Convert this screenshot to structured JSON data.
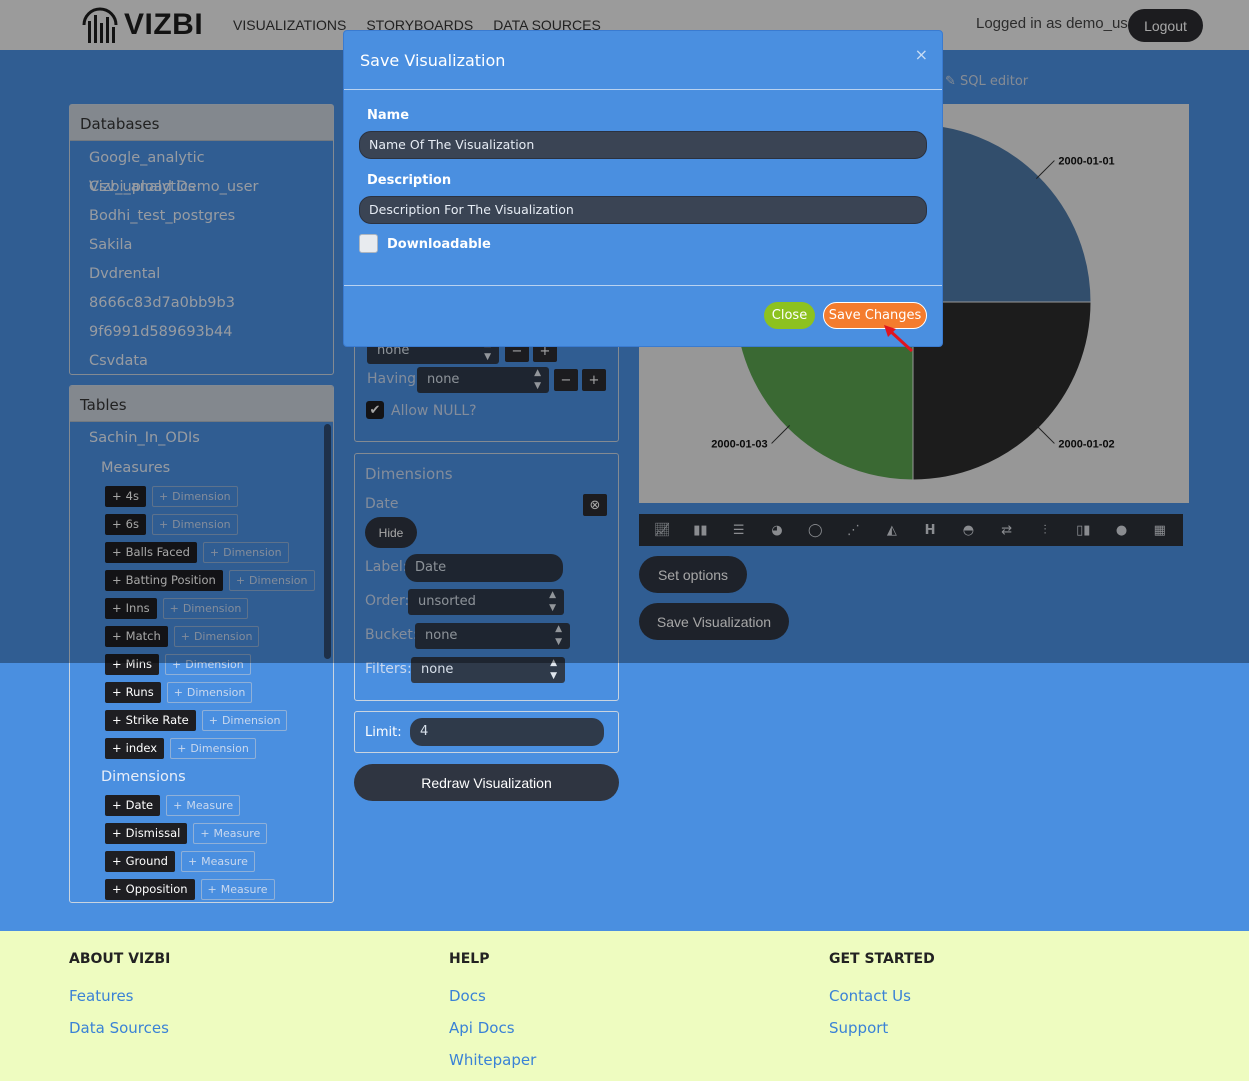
{
  "header": {
    "logo": "VIZBI",
    "nav": [
      "VISUALIZATIONS",
      "STORYBOARDS",
      "DATA SOURCES"
    ],
    "logged_in": "Logged in as demo_user",
    "logout": "Logout"
  },
  "databases": {
    "title": "Databases",
    "items": [
      "Google_analytic Vizbi_analytics",
      "Csv_upload Demo_user",
      "Bodhi_test_postgres",
      "Sakila",
      "Dvdrental",
      "8666c83d7a0bb9b3",
      "9f6991d589693b44",
      "Csvdata"
    ]
  },
  "tables": {
    "title": "Tables",
    "table_name": "Sachin_In_ODIs",
    "measures_label": "Measures",
    "measures": [
      "4s",
      "6s",
      "Balls Faced",
      "Batting Position",
      "Inns",
      "Match",
      "Mins",
      "Runs",
      "Strike Rate",
      "index"
    ],
    "measure_alt": "Dimension",
    "dimensions_label": "Dimensions",
    "dimensions": [
      "Date",
      "Dismissal",
      "Ground",
      "Opposition"
    ],
    "dimension_alt": "Measure",
    "plus": "+"
  },
  "query": {
    "row1_select": "none",
    "having_label": "Having:",
    "having_select": "none",
    "allow_null": "Allow NULL?",
    "minus": "−",
    "plus": "+"
  },
  "dimensions_panel": {
    "title": "Dimensions",
    "field": "Date",
    "hide": "Hide",
    "label_label": "Label:",
    "label_value": "Date",
    "order_label": "Order:",
    "order_value": "unsorted",
    "bucket_label": "Bucket:",
    "bucket_value": "none",
    "filters_label": "Filters:",
    "filters_value": "none"
  },
  "limit": {
    "label": "Limit:",
    "value": "4"
  },
  "redraw": "Redraw Visualization",
  "sql_editor": "SQL editor",
  "set_options": "Set options",
  "save_visualization": "Save Visualization",
  "chart_data": {
    "type": "pie",
    "categories": [
      "2000-01-01",
      "2000-01-02",
      "2000-01-03"
    ],
    "values": [
      25,
      25,
      25
    ],
    "colors": [
      "#4e79a7",
      "#2b2b2b",
      "#59a14f"
    ]
  },
  "toolbar_icons": [
    "line-chart-icon",
    "bar-chart-icon",
    "list-icon",
    "pie-chart-icon",
    "donut-icon",
    "scatter-icon",
    "area-chart-icon",
    "heading-icon",
    "gauge-icon",
    "exchange-icon",
    "combo-chart-icon",
    "column-chart-icon",
    "globe-icon",
    "table-icon"
  ],
  "modal": {
    "title": "Save Visualization",
    "close_x": "×",
    "name_label": "Name",
    "name_placeholder": "Name Of The Visualization",
    "description_label": "Description",
    "description_placeholder": "Description For The Visualization",
    "downloadable_label": "Downloadable",
    "close_button": "Close",
    "save_button": "Save Changes"
  },
  "footer": {
    "about": {
      "title": "ABOUT VIZBI",
      "links": [
        "Features",
        "Data Sources"
      ]
    },
    "help": {
      "title": "HELP",
      "links": [
        "Docs",
        "Api Docs",
        "Whitepaper"
      ]
    },
    "started": {
      "title": "GET STARTED",
      "links": [
        "Contact Us",
        "Support"
      ]
    }
  }
}
